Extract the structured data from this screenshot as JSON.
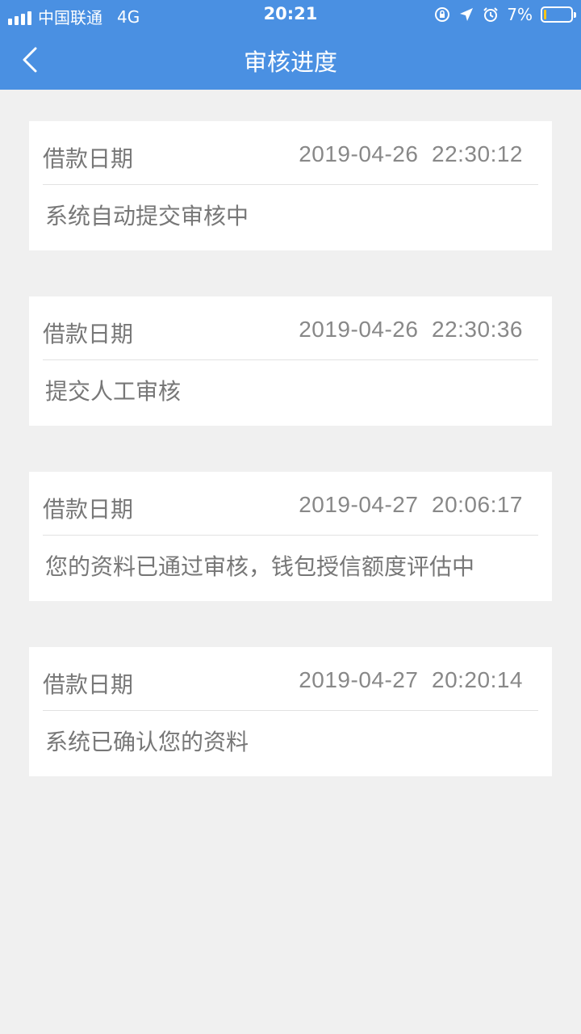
{
  "status_bar": {
    "carrier": "中国联通",
    "network": "4G",
    "time": "20:21",
    "battery_percent": "7%",
    "battery_level": 0.07
  },
  "nav": {
    "title": "审核进度",
    "back_icon": "chevron-left-icon"
  },
  "records": [
    {
      "label": "借款日期",
      "date": "2019-04-26  22:30:12",
      "status": "系统自动提交审核中"
    },
    {
      "label": "借款日期",
      "date": "2019-04-26  22:30:36",
      "status": "提交人工审核"
    },
    {
      "label": "借款日期",
      "date": "2019-04-27  20:06:17",
      "status": "您的资料已通过审核，钱包授信额度评估中"
    },
    {
      "label": "借款日期",
      "date": "2019-04-27  20:20:14",
      "status": "系统已确认您的资料"
    }
  ],
  "colors": {
    "accent": "#4a90e2",
    "background": "#f0f0f0",
    "card": "#ffffff"
  }
}
